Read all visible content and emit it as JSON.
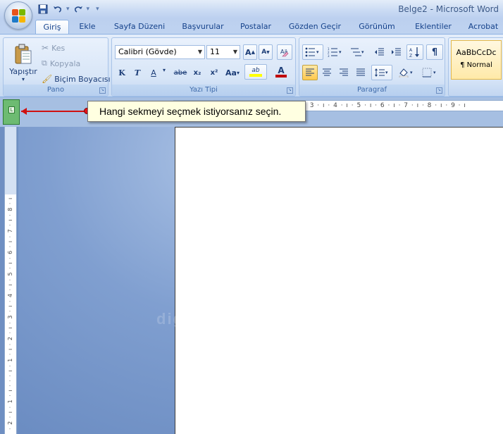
{
  "window": {
    "title": "Belge2 - Microsoft Word"
  },
  "quick_access": {
    "save_icon": "save-icon",
    "undo_icon": "undo-icon",
    "redo_icon": "redo-icon",
    "customize": "▾"
  },
  "tabs": [
    {
      "label": "Giriş",
      "active": true
    },
    {
      "label": "Ekle"
    },
    {
      "label": "Sayfa Düzeni"
    },
    {
      "label": "Başvurular"
    },
    {
      "label": "Postalar"
    },
    {
      "label": "Gözden Geçir"
    },
    {
      "label": "Görünüm"
    },
    {
      "label": "Eklentiler"
    },
    {
      "label": "Acrobat"
    }
  ],
  "ribbon": {
    "clipboard": {
      "label": "Pano",
      "paste": "Yapıştır",
      "cut": "Kes",
      "copy": "Kopyala",
      "format_painter": "Biçim Boyacısı"
    },
    "font": {
      "label": "Yazı Tipi",
      "font_name": "Calibri (Gövde)",
      "font_size": "11",
      "bold": "K",
      "italic": "T",
      "underline": "A",
      "strikethrough": "abe",
      "subscript": "x₂",
      "superscript": "x²",
      "change_case": "Aa",
      "grow": "A",
      "shrink": "A",
      "highlight_color": "#ffff00",
      "font_color": "#c00000"
    },
    "paragraph": {
      "label": "Paragraf"
    },
    "styles": {
      "sample": "AaBbCcDc",
      "name": "¶ Normal"
    }
  },
  "ruler": {
    "horizontal": "· 3 · ı · 4 · ı · 5 · ı · 6 · ı · 7 · ı · 8 · ı · 9 · ı",
    "vertical": "· 2 · ı · 1 · ı · · · ı · 1 · ı · 2 · ı · 3 · ı · 4 · ı · 5 · ı · 6 · ı · 7 · ı · 8 · ı"
  },
  "tooltip": {
    "text": "Hangi sekmeyi seçmek istiyorsanız seçin."
  },
  "watermark": "digitalders.com"
}
